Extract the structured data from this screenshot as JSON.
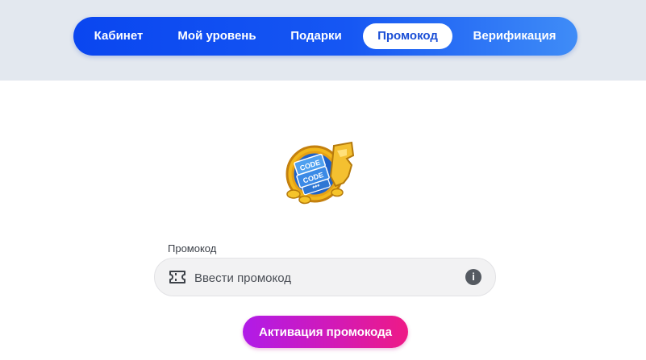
{
  "nav": {
    "items": [
      {
        "label": "Кабинет"
      },
      {
        "label": "Мой уровень"
      },
      {
        "label": "Подарки"
      },
      {
        "label": "Промокод",
        "active": true
      },
      {
        "label": "Верификация"
      }
    ],
    "gradient_start": "#0a46f0",
    "gradient_end": "#3f8cf7"
  },
  "emblem": {
    "icon": "promo-code-coin-icon",
    "ticket_texts": [
      "CODE",
      "CODE",
      "***"
    ]
  },
  "promo": {
    "label": "Промокод",
    "placeholder": "Ввести промокод",
    "value": "",
    "leading_icon": "ticket-icon",
    "trailing_icon": "info-icon",
    "info_glyph": "i"
  },
  "activate_button": {
    "label": "Активация промокода",
    "gradient_start": "#b01be8",
    "gradient_end": "#ee1a86"
  }
}
